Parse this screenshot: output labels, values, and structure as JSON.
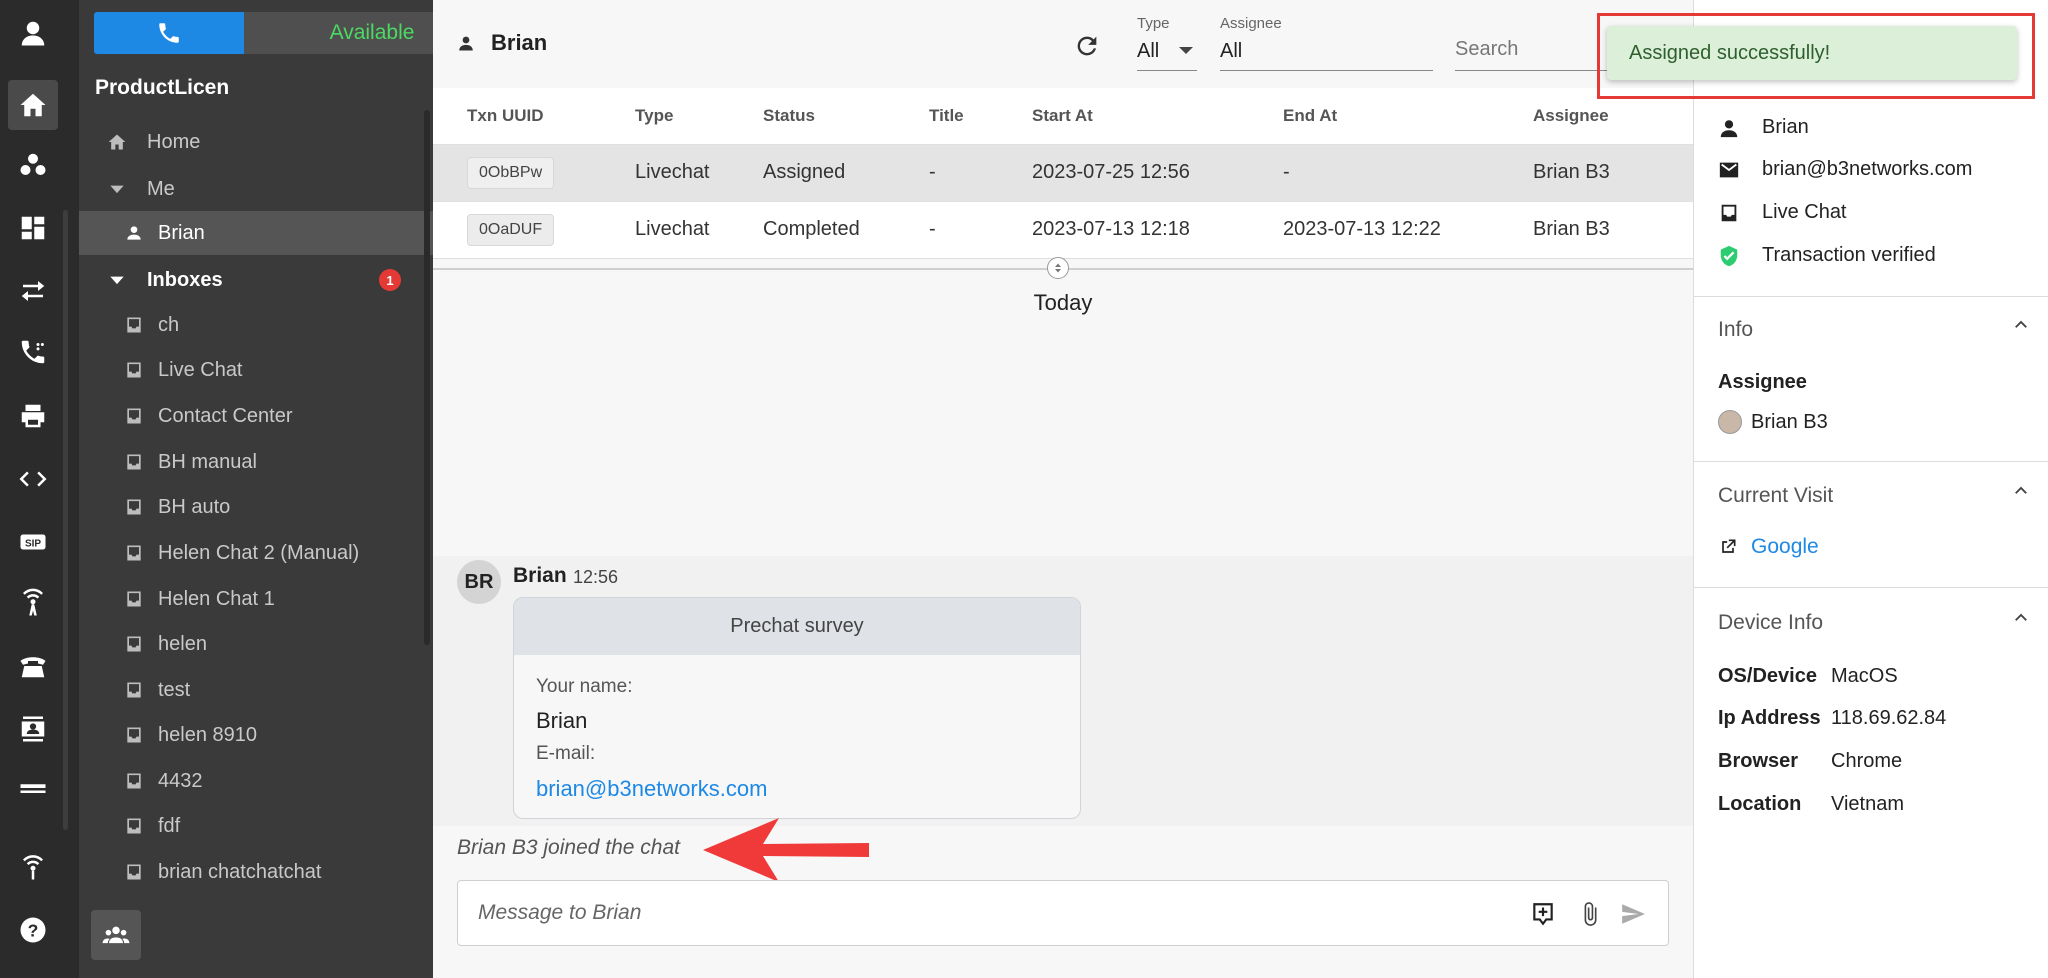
{
  "nav": {
    "status": "Available",
    "org": "ProductLicen",
    "items": [
      {
        "label": "Home"
      },
      {
        "label": "Me"
      },
      {
        "label": "Brian"
      },
      {
        "label": "Inboxes"
      },
      {
        "label": "ch"
      },
      {
        "label": "Live Chat"
      },
      {
        "label": "Contact Center"
      },
      {
        "label": "BH manual"
      },
      {
        "label": "BH auto"
      },
      {
        "label": "Helen Chat 2 (Manual)"
      },
      {
        "label": "Helen Chat 1"
      },
      {
        "label": "helen"
      },
      {
        "label": "test"
      },
      {
        "label": "helen 8910"
      },
      {
        "label": "4432"
      },
      {
        "label": "fdf"
      },
      {
        "label": "brian chatchatchat"
      }
    ],
    "inbox_badge": "1"
  },
  "header": {
    "title": "Brian",
    "type_label": "Type",
    "type_value": "All",
    "assignee_label": "Assignee",
    "assignee_value": "All",
    "search_placeholder": "Search"
  },
  "table": {
    "columns": [
      "Txn UUID",
      "Type",
      "Status",
      "Title",
      "Start At",
      "End At",
      "Assignee"
    ],
    "rows": [
      {
        "uuid": "0ObBPw",
        "type": "Livechat",
        "status": "Assigned",
        "title": "-",
        "start": "2023-07-25 12:56",
        "end": "-",
        "assignee": "Brian B3"
      },
      {
        "uuid": "0OaDUF",
        "type": "Livechat",
        "status": "Completed",
        "title": "-",
        "start": "2023-07-13 12:18",
        "end": "2023-07-13 12:22",
        "assignee": "Brian B3"
      }
    ]
  },
  "chat": {
    "day_label": "Today",
    "avatar_initials": "BR",
    "sender": "Brian",
    "time": "12:56",
    "survey": {
      "title": "Prechat survey",
      "name_label": "Your name:",
      "name_value": "Brian",
      "email_label": "E-mail:",
      "email_value": "brian@b3networks.com"
    },
    "system_message": "Brian B3 joined the chat",
    "composer_placeholder": "Message to Brian"
  },
  "contact": {
    "name": "Brian",
    "email": "brian@b3networks.com",
    "channel": "Live Chat",
    "verified": "Transaction verified"
  },
  "info": {
    "title": "Info",
    "assignee_label": "Assignee",
    "assignee_value": "Brian B3"
  },
  "visit": {
    "title": "Current Visit",
    "link": "Google"
  },
  "device": {
    "title": "Device Info",
    "rows": [
      {
        "label": "OS/Device",
        "value": "MacOS"
      },
      {
        "label": "Ip Address",
        "value": "118.69.62.84"
      },
      {
        "label": "Browser",
        "value": "Chrome"
      },
      {
        "label": "Location",
        "value": "Vietnam"
      }
    ]
  },
  "toast": {
    "message": "Assigned successfully!"
  },
  "colors": {
    "accent": "#1e88e5",
    "available": "#4cd964",
    "verified": "#2ecc71",
    "alert": "#e53935"
  }
}
